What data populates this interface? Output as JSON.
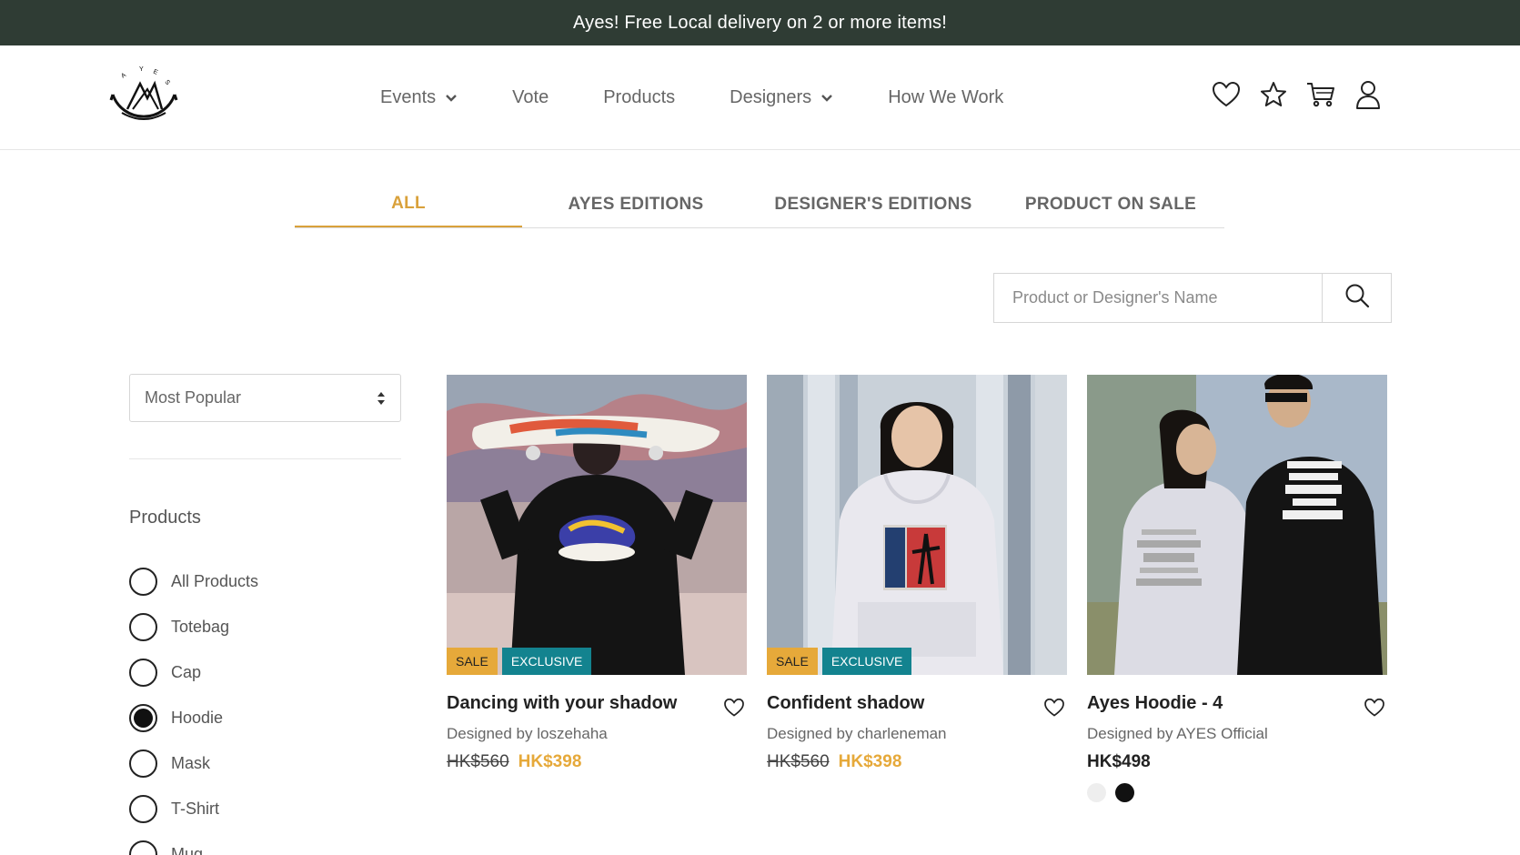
{
  "promo": {
    "text": "Ayes! Free Local delivery on 2 or more items!"
  },
  "logo": {
    "letters": "A Y E S",
    "alt": "AYES"
  },
  "nav": [
    {
      "label": "Events",
      "has_dropdown": true
    },
    {
      "label": "Vote",
      "has_dropdown": false
    },
    {
      "label": "Products",
      "has_dropdown": false
    },
    {
      "label": "Designers",
      "has_dropdown": true
    },
    {
      "label": "How We Work",
      "has_dropdown": false
    }
  ],
  "header_icons": [
    "heart-icon",
    "star-icon",
    "cart-icon",
    "user-icon"
  ],
  "tabs": [
    {
      "label": "ALL",
      "active": true
    },
    {
      "label": "AYES EDITIONS",
      "active": false
    },
    {
      "label": "DESIGNER'S EDITIONS",
      "active": false
    },
    {
      "label": "PRODUCT ON SALE",
      "active": false
    }
  ],
  "search": {
    "placeholder": "Product or Designer's Name",
    "value": ""
  },
  "sort": {
    "selected": "Most Popular"
  },
  "filter": {
    "title": "Products",
    "options": [
      {
        "label": "All Products",
        "checked": false
      },
      {
        "label": "Totebag",
        "checked": false
      },
      {
        "label": "Cap",
        "checked": false
      },
      {
        "label": "Hoodie",
        "checked": true
      },
      {
        "label": "Mask",
        "checked": false
      },
      {
        "label": "T-Shirt",
        "checked": false
      },
      {
        "label": "Mug",
        "checked": false
      }
    ]
  },
  "products": [
    {
      "title": "Dancing with your shadow",
      "designer": "Designed by loszehaha",
      "old_price": "HK$560",
      "price": "HK$398",
      "badges": [
        "SALE",
        "EXCLUSIVE"
      ]
    },
    {
      "title": "Confident shadow",
      "designer": "Designed by charleneman",
      "old_price": "HK$560",
      "price": "HK$398",
      "badges": [
        "SALE",
        "EXCLUSIVE"
      ]
    },
    {
      "title": "Ayes Hoodie - 4",
      "designer": "Designed by AYES Official",
      "price": "HK$498",
      "swatches": [
        "#eeeeee",
        "#111111"
      ]
    }
  ],
  "colors": {
    "promo_bg": "#2f3c34",
    "accent": "#d9a13b",
    "sale": "#e6a93a",
    "exclusive": "#13838f"
  }
}
